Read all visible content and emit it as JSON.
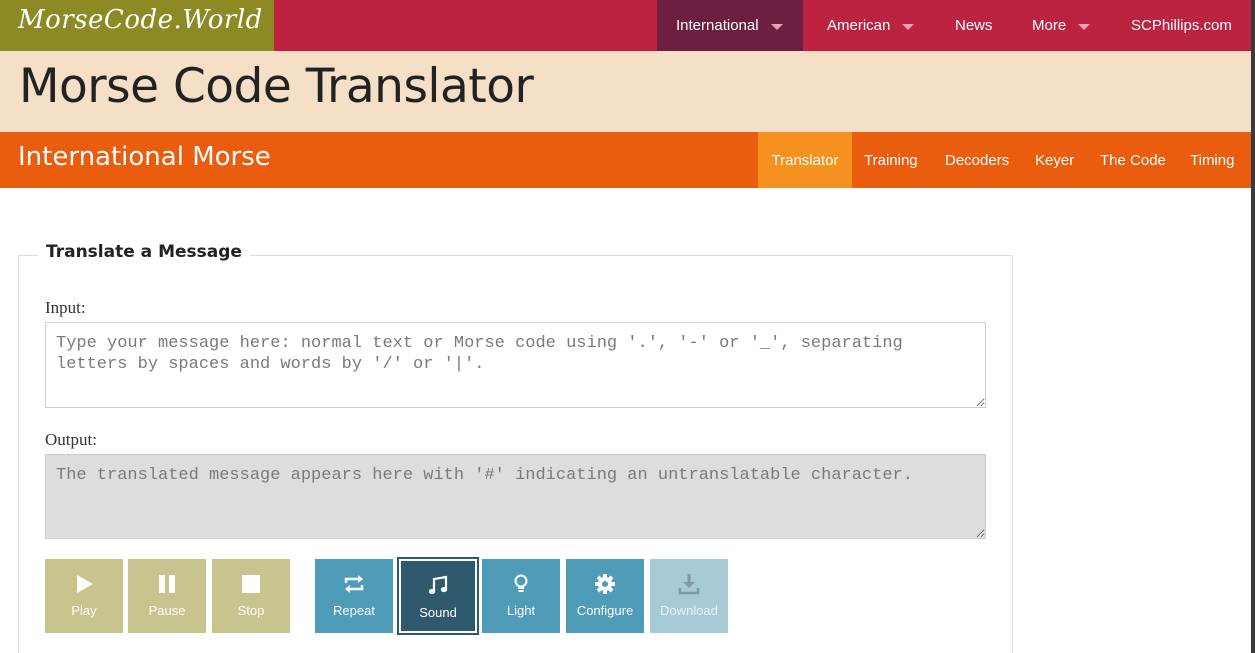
{
  "site": {
    "logo_text": "MorseCode.World"
  },
  "top_nav": {
    "items": [
      {
        "label": "International",
        "has_dropdown": true,
        "active": true
      },
      {
        "label": "American",
        "has_dropdown": true
      },
      {
        "label": "News"
      },
      {
        "label": "More",
        "has_dropdown": true
      },
      {
        "label": "SCPhillips.com"
      }
    ]
  },
  "page": {
    "title": "Morse Code Translator"
  },
  "section": {
    "title": "International Morse",
    "nav": [
      {
        "label": "Translator",
        "active": true
      },
      {
        "label": "Training"
      },
      {
        "label": "Decoders"
      },
      {
        "label": "Keyer"
      },
      {
        "label": "The Code"
      },
      {
        "label": "Timing"
      }
    ]
  },
  "translator": {
    "legend": "Translate a Message",
    "input_label": "Input:",
    "input_placeholder": "Type your message here: normal text or Morse code using '.', '-' or '_', separating letters by spaces and words by '/' or '|'.",
    "input_value": "",
    "output_label": "Output:",
    "output_placeholder": "The translated message appears here with '#' indicating an untranslatable character.",
    "output_value": ""
  },
  "controls": {
    "play": {
      "label": "Play",
      "icon": "play-icon"
    },
    "pause": {
      "label": "Pause",
      "icon": "pause-icon"
    },
    "stop": {
      "label": "Stop",
      "icon": "stop-icon"
    },
    "repeat": {
      "label": "Repeat",
      "icon": "repeat-icon"
    },
    "sound": {
      "label": "Sound",
      "icon": "music-note-icon",
      "selected": true
    },
    "light": {
      "label": "Light",
      "icon": "lightbulb-icon"
    },
    "configure": {
      "label": "Configure",
      "icon": "gear-icon"
    },
    "download": {
      "label": "Download",
      "icon": "download-icon",
      "disabled": true
    }
  },
  "colors": {
    "topbar": "#bb2340",
    "logo_bg": "#8b8a24",
    "title_band": "#f5dfc6",
    "section_band": "#ea5c0e",
    "section_active": "#f5911f",
    "olive_button": "#c8c48e",
    "teal_button": "#4e9cb8",
    "selected_button": "#2f5a6e"
  }
}
